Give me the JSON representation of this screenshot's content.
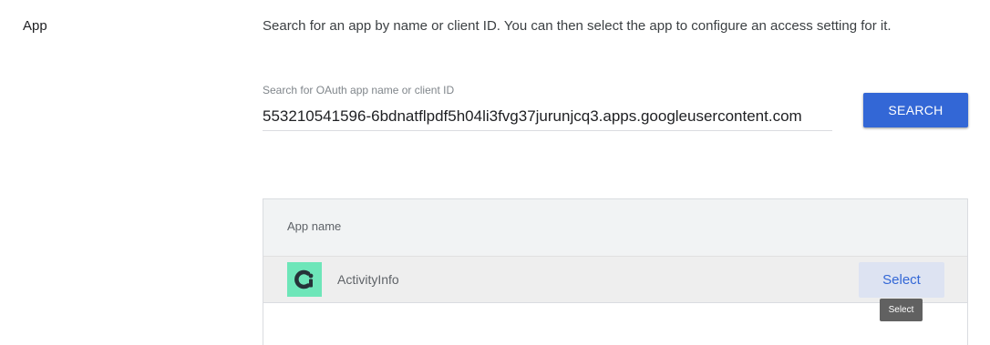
{
  "section": {
    "label": "App",
    "description": "Search for an app by name or client ID. You can then select the app to configure an access setting for it."
  },
  "search": {
    "label": "Search for OAuth app name or client ID",
    "value": "553210541596-6bdnatflpdf5h04li3fvg37jurunjcq3.apps.googleusercontent.com",
    "button_label": "SEARCH",
    "button_color": "#3367d6"
  },
  "results": {
    "column_header": "App name",
    "rows": [
      {
        "name": "ActivityInfo",
        "icon": "activityinfo-logo-icon",
        "icon_color": "#6ee6b9",
        "action_label": "Select"
      }
    ]
  },
  "tooltip": {
    "text": "Select"
  }
}
